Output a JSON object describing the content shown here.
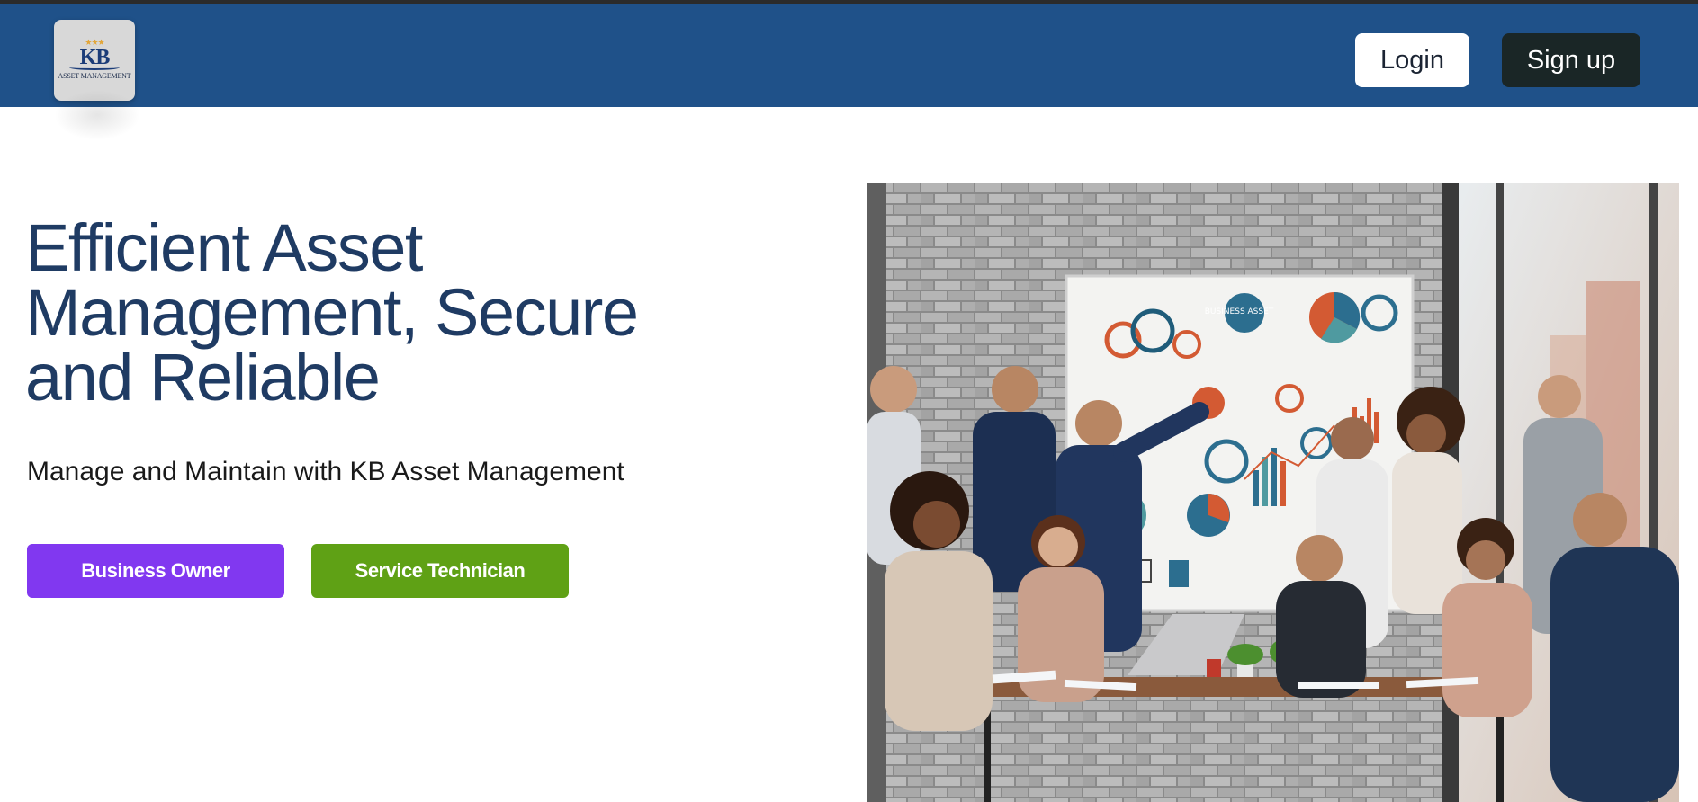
{
  "header": {
    "logo": {
      "mark": "KB",
      "text": "ASSET MANAGEMENT",
      "stars": "★★★"
    },
    "login_label": "Login",
    "signup_label": "Sign up"
  },
  "hero": {
    "title": "Efficient Asset Management, Secure and Reliable",
    "subtitle": "Manage and Maintain with KB Asset Management",
    "buttons": {
      "business_owner": "Business Owner",
      "service_technician": "Service Technician"
    },
    "image": {
      "whiteboard_text": "BUSINESS\nASSET"
    }
  },
  "colors": {
    "header_bg": "#1f5189",
    "title": "#1f3b63",
    "business_owner_btn": "#8138f0",
    "service_technician_btn": "#5fa115",
    "signup_btn": "#1a2626"
  }
}
